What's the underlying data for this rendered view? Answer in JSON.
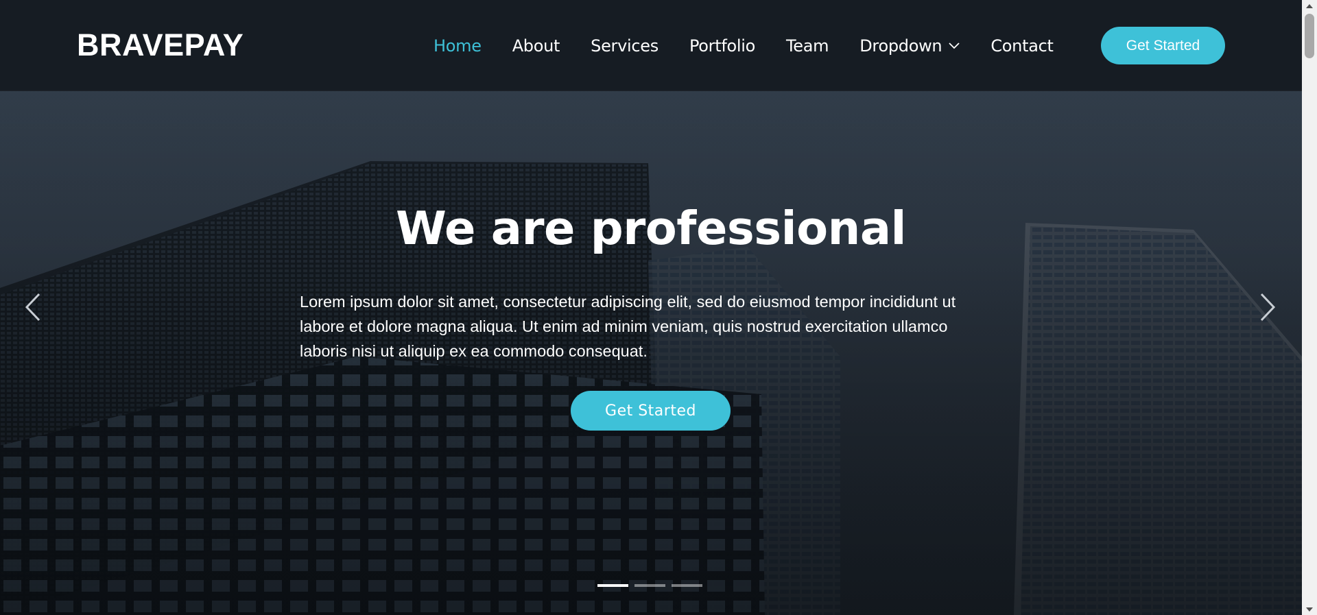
{
  "header": {
    "logo": "BRAVEPAY",
    "nav": [
      {
        "label": "Home",
        "active": true
      },
      {
        "label": "About",
        "active": false
      },
      {
        "label": "Services",
        "active": false
      },
      {
        "label": "Portfolio",
        "active": false
      },
      {
        "label": "Team",
        "active": false
      },
      {
        "label": "Dropdown",
        "active": false,
        "icon": "chevron-down-icon"
      },
      {
        "label": "Contact",
        "active": false
      }
    ],
    "cta_label": "Get Started"
  },
  "hero": {
    "title": "We are professional",
    "text": "Lorem ipsum dolor sit amet, consectetur adipiscing elit, sed do eiusmod tempor incididunt ut labore et dolore magna aliqua. Ut enim ad minim veniam, quis nostrud exercitation ullamco laboris nisi ut aliquip ex ea commodo consequat.",
    "cta_label": "Get Started",
    "prev_icon": "chevron-left-icon",
    "next_icon": "chevron-right-icon",
    "slides": 3,
    "active_slide": 0
  },
  "colors": {
    "accent": "#3ec1d8",
    "header_bg": "#141a20",
    "text": "#ffffff"
  }
}
